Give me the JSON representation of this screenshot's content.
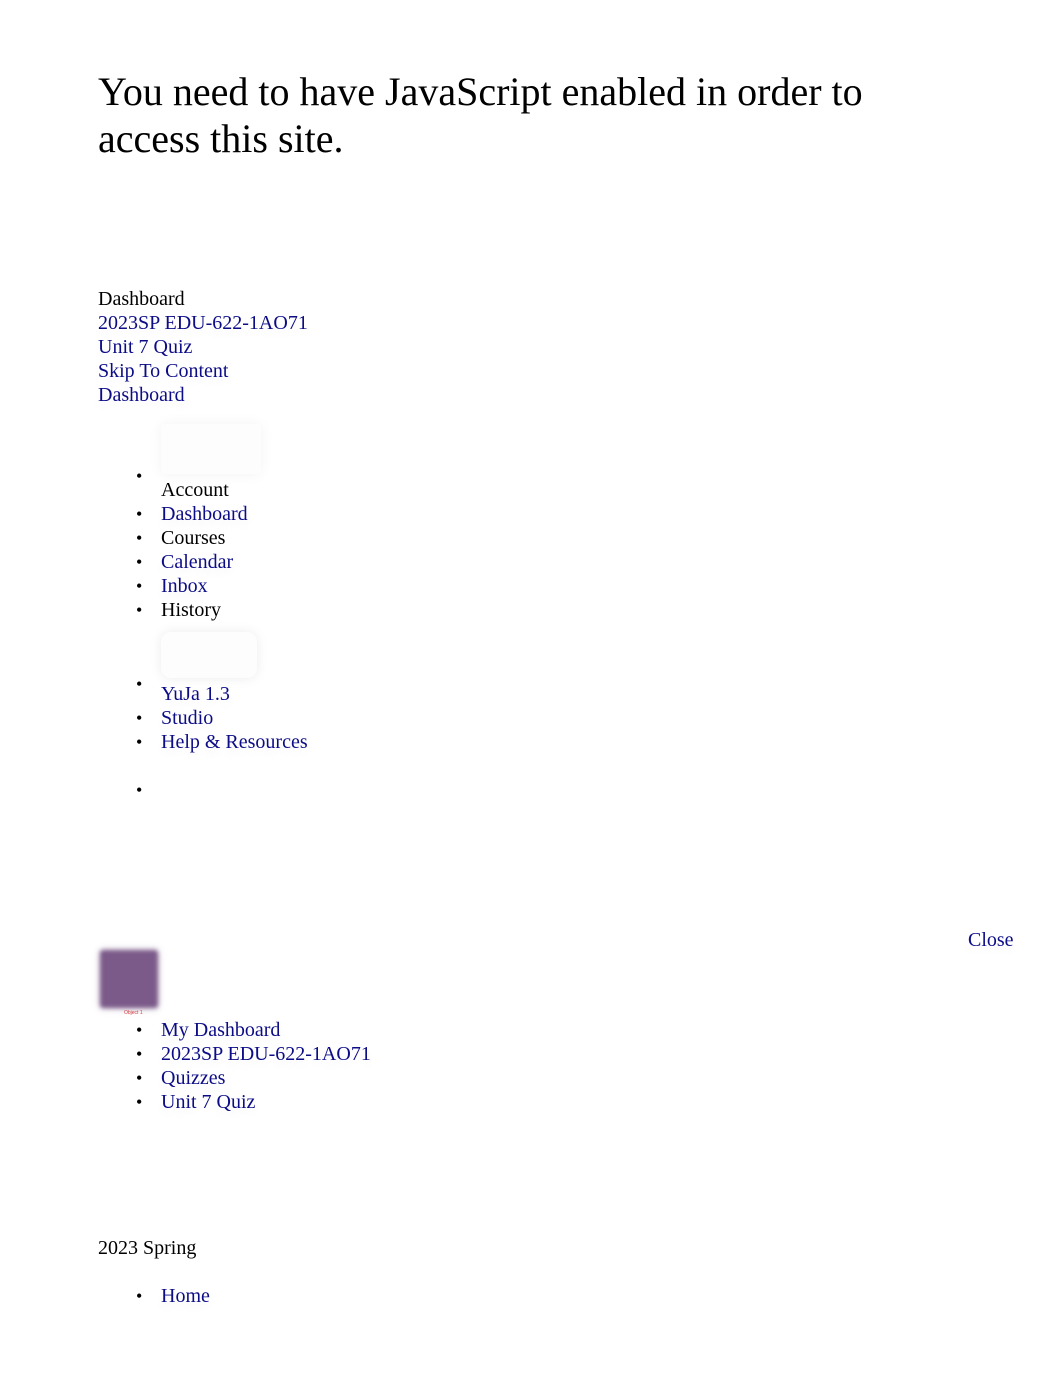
{
  "noscript_message": "You need to have JavaScript enabled in order to access this site.",
  "breadcrumbs": {
    "current": "Dashboard",
    "items": [
      {
        "label": "2023SP EDU-622-1AO71"
      },
      {
        "label": "Unit 7 Quiz"
      },
      {
        "label": "Skip To Content"
      },
      {
        "label": "Dashboard"
      }
    ]
  },
  "global_nav": {
    "account_label": "Account",
    "items": [
      {
        "label": "Dashboard",
        "link": true
      },
      {
        "label": "Courses",
        "link": false
      },
      {
        "label": "Calendar",
        "link": true
      },
      {
        "label": "Inbox",
        "link": true
      },
      {
        "label": "History",
        "link": false
      }
    ],
    "yuja_label": "YuJa 1.3",
    "items_after": [
      {
        "label": "Studio"
      },
      {
        "label": "Help & Resources"
      }
    ]
  },
  "mobile_nav": {
    "close_label": "Close",
    "course_image_caption": "Object 1",
    "course_image_color": "#7b5a89",
    "items": [
      {
        "label": "My Dashboard"
      },
      {
        "label": "2023SP EDU-622-1AO71"
      },
      {
        "label": "Quizzes"
      },
      {
        "label": "Unit 7 Quiz"
      }
    ]
  },
  "term": "2023 Spring",
  "section_nav": {
    "items": [
      {
        "label": "Home"
      }
    ]
  },
  "colors": {
    "link": "#0c0c86",
    "text": "#000000",
    "background": "#ffffff"
  }
}
